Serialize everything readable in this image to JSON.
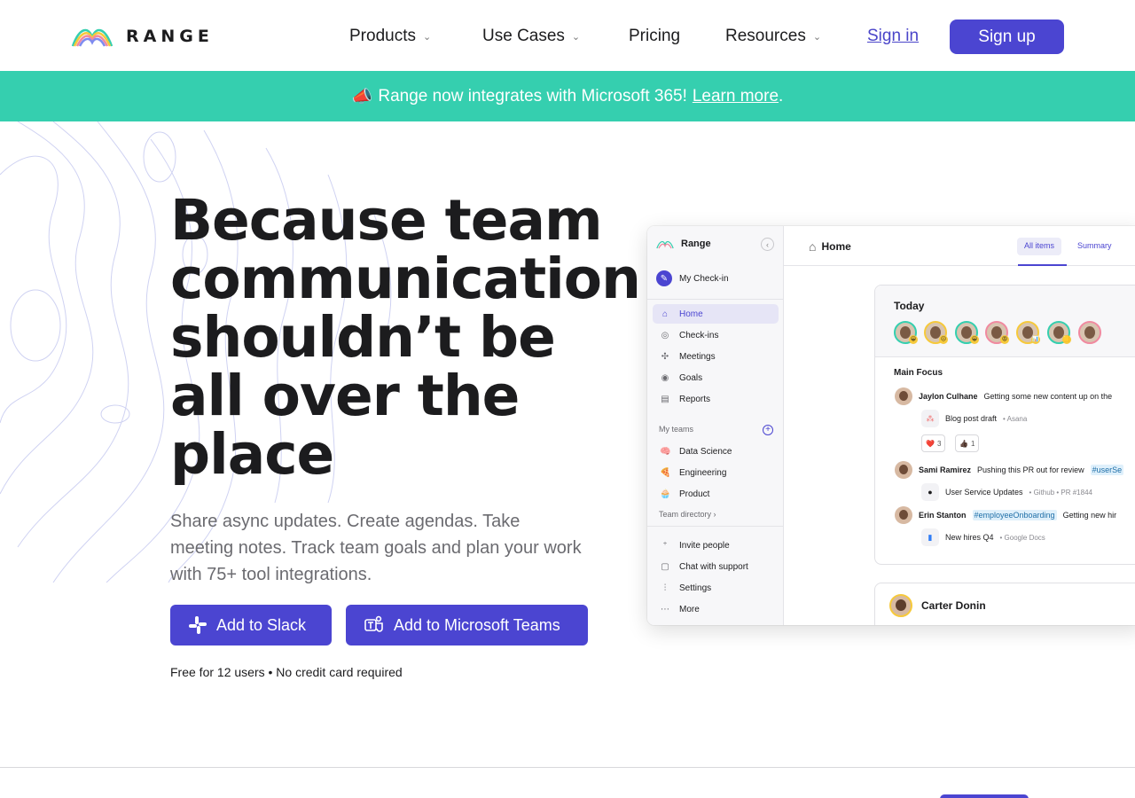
{
  "nav": {
    "logo_text": "RANGE",
    "items": [
      {
        "label": "Products",
        "has_dropdown": true
      },
      {
        "label": "Use Cases",
        "has_dropdown": true
      },
      {
        "label": "Pricing",
        "has_dropdown": false
      },
      {
        "label": "Resources",
        "has_dropdown": true
      }
    ],
    "signin_label": "Sign in",
    "signup_label": "Sign up"
  },
  "banner": {
    "icon": "📣",
    "text": "Range now integrates with Microsoft 365!",
    "link_label": "Learn more",
    "trailing": "."
  },
  "hero": {
    "headline": "Because team communication shouldn’t be all over the place",
    "subtext": "Share async updates. Create agendas. Take meeting notes. Track team goals and plan your work with 75+ tool integrations.",
    "slack_button": "Add to Slack",
    "teams_button": "Add to Microsoft Teams",
    "footnote": "Free for 12 users • No credit card required"
  },
  "app": {
    "workspace": "Range",
    "my_checkin": "My Check-in",
    "nav_items": [
      {
        "label": "Home",
        "icon": "home-icon",
        "active": true
      },
      {
        "label": "Check-ins",
        "icon": "check-circle-icon",
        "active": false
      },
      {
        "label": "Meetings",
        "icon": "meetings-icon",
        "active": false
      },
      {
        "label": "Goals",
        "icon": "target-icon",
        "active": false
      },
      {
        "label": "Reports",
        "icon": "clipboard-icon",
        "active": false
      }
    ],
    "my_teams_label": "My teams",
    "teams": [
      {
        "label": "Data Science",
        "icon": "🧠"
      },
      {
        "label": "Engineering",
        "icon": "🍕"
      },
      {
        "label": "Product",
        "icon": "🧁"
      }
    ],
    "team_directory": "Team directory",
    "footer_items": [
      {
        "label": "Invite people",
        "icon": "invite-icon"
      },
      {
        "label": "Chat with support",
        "icon": "chat-icon"
      },
      {
        "label": "Settings",
        "icon": "sliders-icon"
      },
      {
        "label": "More",
        "icon": "more-icon"
      }
    ],
    "page_title": "Home",
    "tabs": [
      "All items",
      "Summary"
    ],
    "card": {
      "title": "Today",
      "section": "Main Focus",
      "entries": [
        {
          "name": "Jaylon Culhane",
          "text": "Getting some new content up on the",
          "tag": ""
        },
        {
          "name": "Sami Ramirez",
          "text": "Pushing this PR out for review",
          "tag": "#userSe"
        },
        {
          "name": "Erin Stanton",
          "text": "Getting new hir",
          "tag": "#employeeOnboarding"
        }
      ],
      "attachments": [
        {
          "label": "Blog post draft",
          "source": "• Asana"
        },
        {
          "label": "User Service Updates",
          "source": "• Github • PR #1844"
        },
        {
          "label": "New hires Q4",
          "source": "• Google Docs"
        }
      ],
      "reactions": [
        {
          "emoji": "❤️",
          "count": "3"
        },
        {
          "emoji": "👍🏿",
          "count": "1"
        }
      ]
    },
    "next_card_name": "Carter Donin"
  }
}
